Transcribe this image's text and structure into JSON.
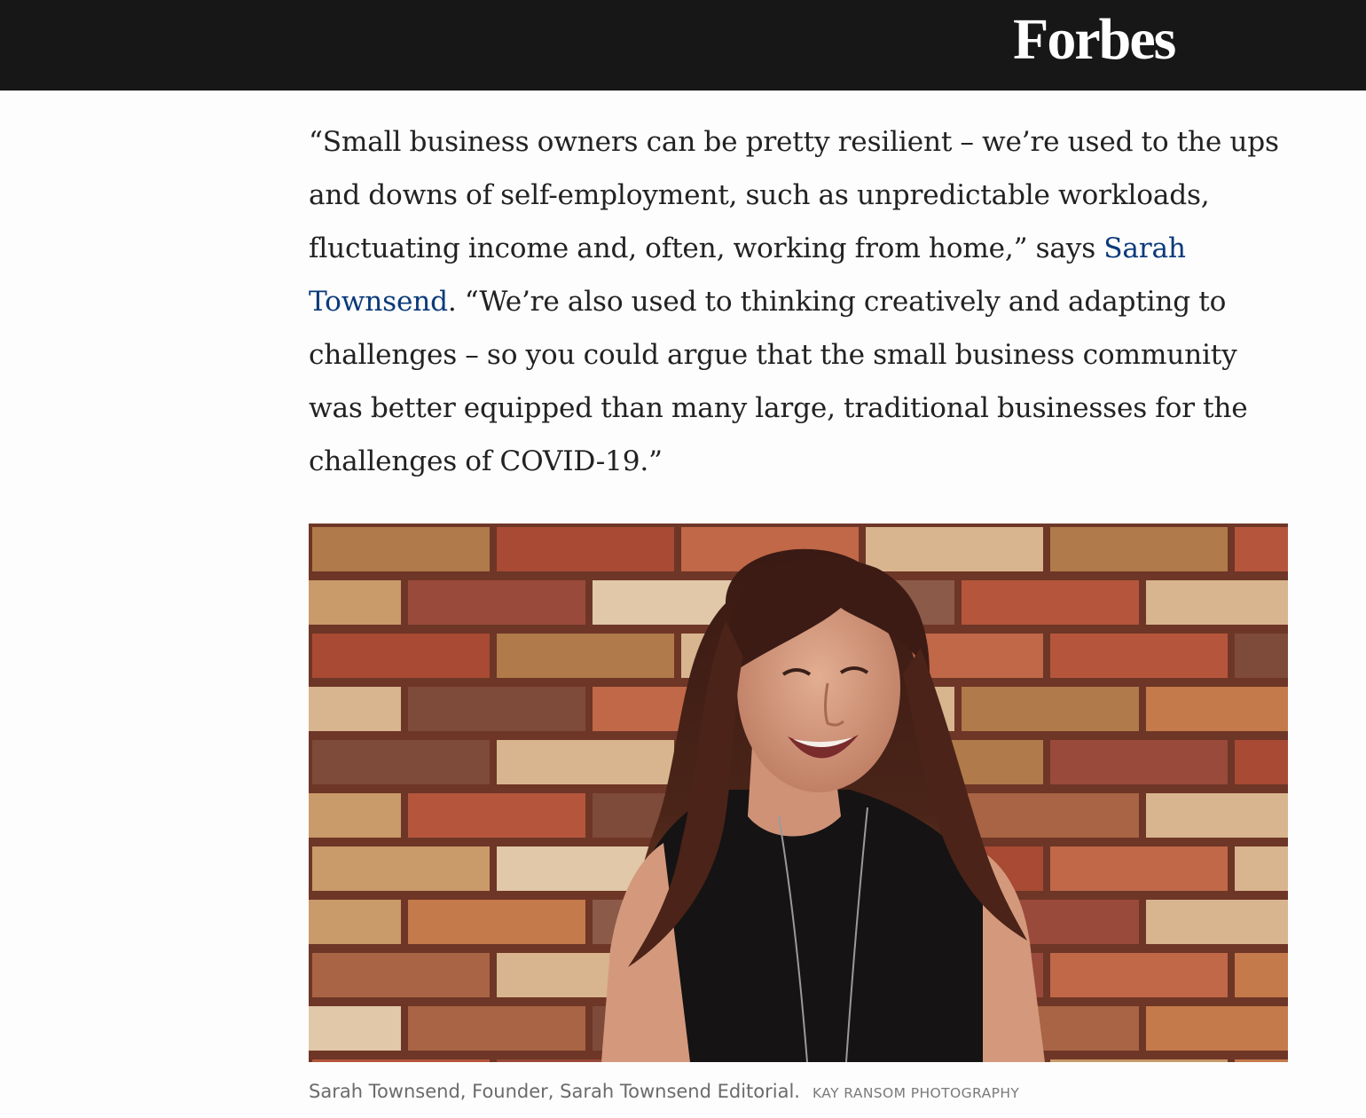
{
  "header": {
    "logo_text": "Forbes"
  },
  "article": {
    "paragraph": {
      "text_before_link": "“Small business owners can be pretty resilient – we’re used to the ups and downs of self-employment, such as unpredictable workloads, fluctuating income and, often, working from home,” says ",
      "link_text": "Sarah Townsend",
      "text_after_link": ". “We’re also used to thinking creatively and adapting to challenges – so you could argue that the small business community was better equipped than many large, traditional businesses for the challenges of COVID-19.”"
    },
    "image": {
      "caption": "Sarah Townsend, Founder, Sarah Townsend Editorial.",
      "credit": "KAY RANSOM PHOTOGRAPHY"
    }
  },
  "colors": {
    "header_bg": "#171717",
    "link": "#0a3a7a",
    "body_text": "#222222",
    "caption_text": "#6b6b6b"
  }
}
